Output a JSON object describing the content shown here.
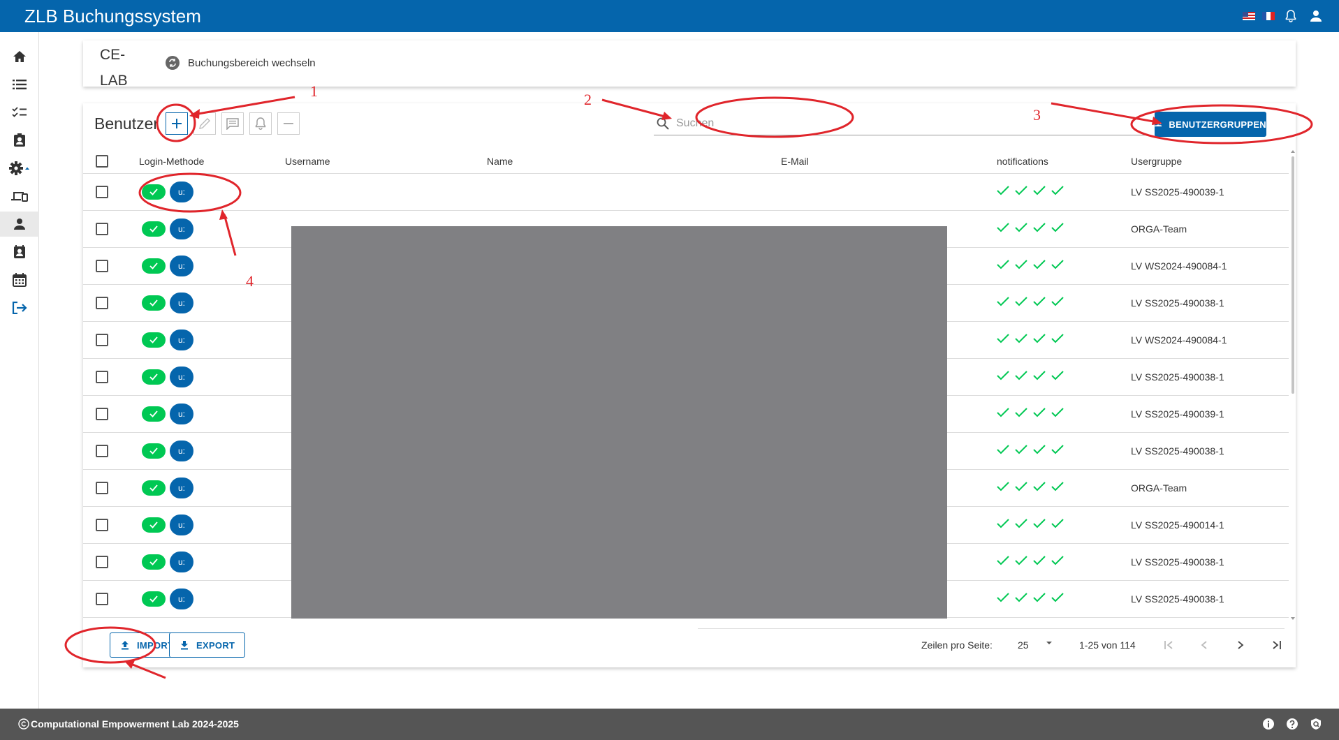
{
  "app": {
    "title": "ZLB Buchungssystem"
  },
  "header": {
    "area_name": "CE-LAB",
    "switch_label": "Buchungsbereich wechseln"
  },
  "toolbar": {
    "title": "Benutzer",
    "search_placeholder": "Suchen",
    "groups_button": "BENUTZERGRUPPEN"
  },
  "columns": {
    "login": "Login-Methode",
    "username": "Username",
    "name": "Name",
    "email": "E-Mail",
    "notifications": "notifications",
    "usergroup": "Usergruppe"
  },
  "rows": [
    {
      "login_badge": "u:",
      "usergroup": "LV SS2025-490039-1"
    },
    {
      "login_badge": "u:",
      "usergroup": "ORGA-Team"
    },
    {
      "login_badge": "u:",
      "usergroup": "LV WS2024-490084-1"
    },
    {
      "login_badge": "u:",
      "usergroup": "LV SS2025-490038-1"
    },
    {
      "login_badge": "u:",
      "usergroup": "LV WS2024-490084-1"
    },
    {
      "login_badge": "u:",
      "usergroup": "LV SS2025-490038-1"
    },
    {
      "login_badge": "u:",
      "usergroup": "LV SS2025-490039-1"
    },
    {
      "login_badge": "u:",
      "usergroup": "LV SS2025-490038-1"
    },
    {
      "login_badge": "u:",
      "usergroup": "ORGA-Team"
    },
    {
      "login_badge": "u:",
      "usergroup": "LV SS2025-490014-1"
    },
    {
      "login_badge": "u:",
      "usergroup": "LV SS2025-490038-1"
    },
    {
      "login_badge": "u:",
      "usergroup": "LV SS2025-490038-1"
    }
  ],
  "actions": {
    "import": "IMPORT",
    "export": "EXPORT"
  },
  "pagination": {
    "rows_label": "Zeilen pro Seite:",
    "rows_per_page": "25",
    "range": "1-25 von 114"
  },
  "footer": {
    "copyright": "Computational Empowerment Lab 2024-2025"
  },
  "annotations": [
    "1",
    "2",
    "3",
    "4"
  ],
  "colors": {
    "primary": "#0565ac",
    "success": "#00c853",
    "annotation": "#e0252b",
    "footer": "#555555"
  },
  "icons": {
    "sidebar": [
      "home-icon",
      "list-icon",
      "checklist-icon",
      "badge-icon",
      "gear-icon",
      "devices-icon",
      "person-icon",
      "contact-icon",
      "calendar-icon",
      "logout-icon"
    ],
    "topbar": [
      "flag-us-icon",
      "flag-fr-icon",
      "bell-icon",
      "account-icon"
    ]
  }
}
